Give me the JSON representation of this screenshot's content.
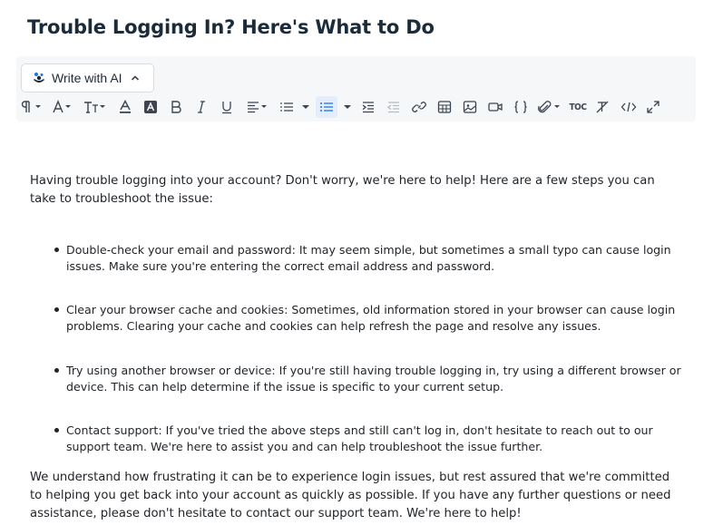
{
  "page": {
    "title": "Trouble Logging In? Here's What to Do"
  },
  "editor": {
    "ai_button_label": "Write with AI",
    "toolbar_tools": [
      {
        "name": "paragraph-format-icon",
        "glyph": "¶"
      },
      {
        "name": "font-family-icon",
        "glyph": "A"
      },
      {
        "name": "font-size-icon",
        "glyph": "IT"
      },
      {
        "name": "text-color-icon",
        "glyph": "A"
      },
      {
        "name": "background-color-icon",
        "glyph": "A"
      },
      {
        "name": "bold-icon",
        "glyph": "B"
      },
      {
        "name": "italic-icon",
        "glyph": "I"
      },
      {
        "name": "underline-icon",
        "glyph": "U"
      },
      {
        "name": "align-icon",
        "glyph": "≡"
      },
      {
        "name": "ordered-list-icon",
        "glyph": "≡"
      },
      {
        "name": "unordered-list-icon",
        "glyph": "≡"
      },
      {
        "name": "indent-icon",
        "glyph": "≡"
      },
      {
        "name": "outdent-icon",
        "glyph": "≡"
      },
      {
        "name": "link-icon",
        "glyph": "🔗"
      },
      {
        "name": "table-icon",
        "glyph": "▦"
      },
      {
        "name": "image-icon",
        "glyph": "▣"
      },
      {
        "name": "video-icon",
        "glyph": "▭"
      },
      {
        "name": "code-block-icon",
        "glyph": "{}"
      },
      {
        "name": "attachment-icon",
        "glyph": "📎"
      },
      {
        "name": "toc-icon",
        "glyph": "TOC"
      },
      {
        "name": "clear-format-icon",
        "glyph": "T"
      },
      {
        "name": "source-code-icon",
        "glyph": "</>"
      },
      {
        "name": "fullscreen-icon",
        "glyph": "⤢"
      }
    ],
    "toc_label": "TOC"
  },
  "body": {
    "intro": "Having trouble logging into your account? Don't worry, we're here to help! Here are a few steps you can take to troubleshoot the issue:",
    "steps": [
      "Double-check your email and password: It may seem simple, but sometimes a small typo can cause login issues. Make sure you're entering the correct email address and password.",
      "Clear your browser cache and cookies: Sometimes, old information stored in your browser can cause login problems. Clearing your cache and cookies can help refresh the page and resolve any issues.",
      "Try using another browser or device: If you're still having trouble logging in, try using a different browser or device. This can help determine if the issue is specific to your current setup.",
      "Contact support: If you've tried the above steps and still can't log in, don't hesitate to reach out to our support team. We're here to assist you and can help troubleshoot the issue further."
    ],
    "closing": "We understand how frustrating it can be to experience login issues, but rest assured that we're committed to helping you get back into your account as quickly as possible. If you have any further questions or need assistance, please don't hesitate to contact our support team. We're here to help!"
  },
  "colors": {
    "title": "#1c2b39",
    "toolbar_bg": "#f6f7f8",
    "active_tool_bg": "#e3edfb",
    "accent": "#1a73e8"
  }
}
